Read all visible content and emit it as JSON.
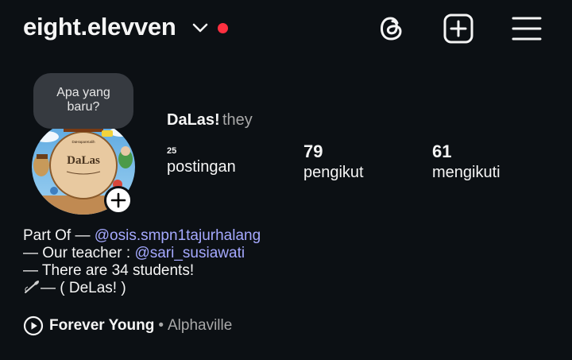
{
  "header": {
    "username": "eight.elevven",
    "chevron_icon": "chevron-down-icon",
    "notification_dot_color": "#ff3040",
    "actions": [
      {
        "icon": "threads-icon"
      },
      {
        "icon": "new-post-icon"
      },
      {
        "icon": "menu-icon"
      }
    ]
  },
  "note": {
    "line1": "Apa yang",
    "line2": "baru?"
  },
  "avatar": {
    "add_icon": "plus-icon",
    "sign_lines": [
      "DaLas",
      "DaHapanKalih"
    ]
  },
  "profile": {
    "display_name": "DaLas!",
    "pronouns": "they"
  },
  "stats": {
    "posts_count": "25",
    "posts_label": "postingan",
    "followers_count": "79",
    "followers_label": "pengikut",
    "following_count": "61",
    "following_label": "mengikuti"
  },
  "bio": {
    "line1_prefix": "Part Of — ",
    "line1_mention": "@osis.smpn1tajurhalang",
    "line2_prefix": "— Our teacher : ",
    "line2_mention": "@sari_susiawati",
    "line3": "— There are 34 students!",
    "line4": "— ( DeLas! )",
    "mention_color": "#a5a9ff"
  },
  "music": {
    "title": "Forever Young",
    "separator": "•",
    "artist": "Alphaville"
  }
}
